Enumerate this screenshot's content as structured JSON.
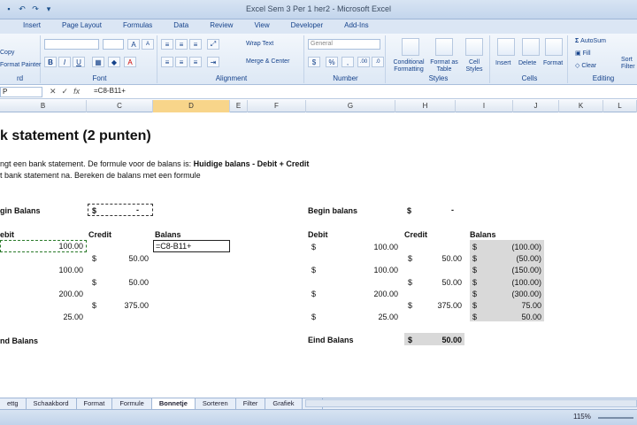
{
  "window": {
    "title": "Excel Sem 3 Per 1 her2 - Microsoft Excel"
  },
  "ribbon": {
    "tabs": [
      "Insert",
      "Page Layout",
      "Formulas",
      "Data",
      "Review",
      "View",
      "Developer",
      "Add-Ins"
    ],
    "clipboard": {
      "copy": "Copy",
      "painter": "Format Painter",
      "label": "rd"
    },
    "font": {
      "label": "Font",
      "bold": "B",
      "italic": "I",
      "underline": "U",
      "grow": "A",
      "shrink": "A"
    },
    "alignment": {
      "wrap": "Wrap Text",
      "merge": "Merge & Center",
      "label": "Alignment"
    },
    "number": {
      "format": "General",
      "dollar": "$",
      "percent": "%",
      "comma": ",",
      "inc": ".00",
      "dec": ".0",
      "label": "Number"
    },
    "styles": {
      "conditional": "Conditional Formatting",
      "table": "Format as Table",
      "cell": "Cell Styles",
      "label": "Styles"
    },
    "cells": {
      "insert": "Insert",
      "delete": "Delete",
      "format": "Format",
      "label": "Cells"
    },
    "editing": {
      "autosum": "AutoSum",
      "fill": "Fill",
      "clear": "Clear",
      "sort": "Sort Filter",
      "label": "Editing"
    }
  },
  "formula_bar": {
    "name": "P",
    "cancel": "✕",
    "enter": "✓",
    "fx": "fx",
    "formula": "=C8-B11+"
  },
  "columns": [
    "B",
    "C",
    "D",
    "E",
    "F",
    "G",
    "H",
    "I",
    "J",
    "K",
    "L"
  ],
  "sheet": {
    "heading": "k statement (2 punten)",
    "instr1_a": "ngt een bank statement. De formule voor de balans is:",
    "instr1_b": "Huidige balans - Debit + Credit",
    "instr2": "t bank statement na. Bereken de balans met een formule",
    "left": {
      "begin_label": "gin Balans",
      "begin_currency": "$",
      "begin_value": "-",
      "hdr_debit": "ebit",
      "hdr_credit": "Credit",
      "hdr_balans": "Balans",
      "edit_formula": "=C8-B11+",
      "rows": [
        {
          "debit": "100.00"
        },
        {
          "currency": "$",
          "credit": "50.00"
        },
        {
          "debit": "100.00"
        },
        {
          "currency": "$",
          "credit": "50.00"
        },
        {
          "debit": "200.00"
        },
        {
          "currency": "$",
          "credit": "375.00"
        },
        {
          "debit": "25.00"
        }
      ],
      "end_label": "nd Balans"
    },
    "right": {
      "begin_label": "Begin balans",
      "begin_currency": "$",
      "begin_value": "-",
      "hdr_debit": "Debit",
      "hdr_credit": "Credit",
      "hdr_balans": "Balans",
      "rows": [
        {
          "debit_cur": "$",
          "debit": "100.00",
          "bal_cur": "$",
          "balans": "(100.00)"
        },
        {
          "credit_cur": "$",
          "credit": "50.00",
          "bal_cur": "$",
          "balans": "(50.00)"
        },
        {
          "debit_cur": "$",
          "debit": "100.00",
          "bal_cur": "$",
          "balans": "(150.00)"
        },
        {
          "credit_cur": "$",
          "credit": "50.00",
          "bal_cur": "$",
          "balans": "(100.00)"
        },
        {
          "debit_cur": "$",
          "debit": "200.00",
          "bal_cur": "$",
          "balans": "(300.00)"
        },
        {
          "credit_cur": "$",
          "credit": "375.00",
          "bal_cur": "$",
          "balans": "75.00"
        },
        {
          "debit_cur": "$",
          "debit": "25.00",
          "bal_cur": "$",
          "balans": "50.00"
        }
      ],
      "end_label": "Eind Balans",
      "end_currency": "$",
      "end_value": "50.00"
    }
  },
  "sheet_tabs": [
    "ettg",
    "Schaakbord",
    "Format",
    "Formule",
    "Bonnetje",
    "Sorteren",
    "Filter",
    "Grafiek"
  ],
  "active_tab": "Bonnetje",
  "status": {
    "zoom": "115%"
  }
}
